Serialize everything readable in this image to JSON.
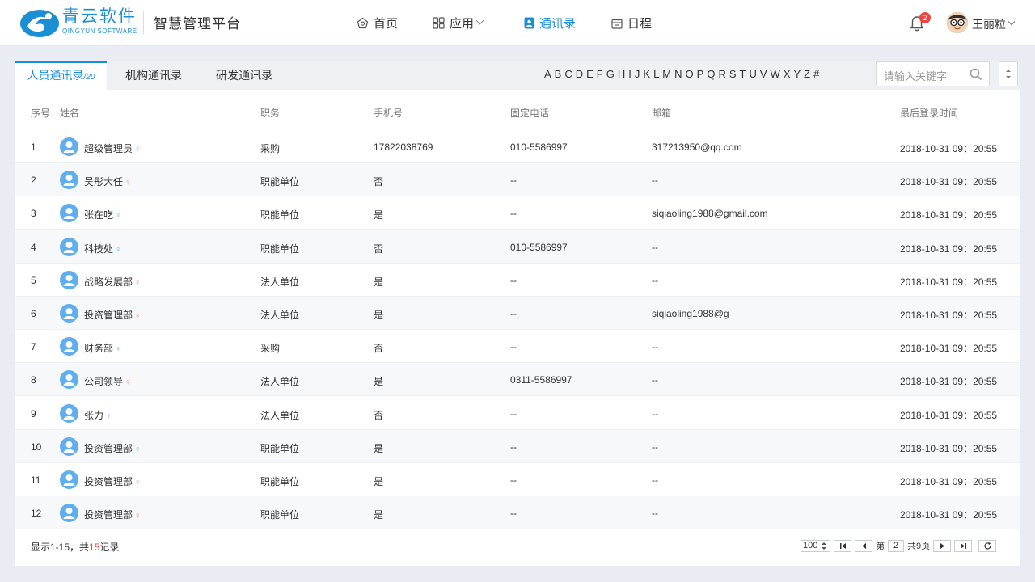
{
  "header": {
    "logo_cn": "青云软件",
    "logo_en": "QINGYUN SOFTWARE",
    "platform_title": "智慧管理平台",
    "nav": {
      "home": "首页",
      "apps": "应用",
      "contacts": "通讯录",
      "calendar": "日程"
    },
    "notification_count": "2",
    "user_name": "王丽粒"
  },
  "tabs": {
    "personnel": "人员通讯录",
    "personnel_count": "/20",
    "org": "机构通讯录",
    "rd": "研发通讯录"
  },
  "alphabet": [
    "A",
    "B",
    "C",
    "D",
    "E",
    "F",
    "G",
    "H",
    "I",
    "J",
    "K",
    "L",
    "M",
    "N",
    "O",
    "P",
    "Q",
    "R",
    "S",
    "T",
    "U",
    "V",
    "W",
    "X",
    "Y",
    "Z",
    "#"
  ],
  "search": {
    "placeholder": "请输入关键字"
  },
  "table": {
    "headers": {
      "index": "序号",
      "name": "姓名",
      "job": "职务",
      "mobile": "手机号",
      "phone": "固定电话",
      "email": "邮箱",
      "last_login": "最后登录时间"
    },
    "rows": [
      {
        "index": "1",
        "name": "超级管理员",
        "gender": "male",
        "job": "采购",
        "mobile": "17822038769",
        "phone": "010-5586997",
        "email": "317213950@qq.com",
        "last_login": "2018-10-31 09：20:55"
      },
      {
        "index": "2",
        "name": "吴彤大任",
        "gender": "female",
        "job": "职能单位",
        "mobile": "否",
        "phone": "--",
        "email": "--",
        "last_login": "2018-10-31 09：20:55"
      },
      {
        "index": "3",
        "name": "张在吃",
        "gender": "male",
        "job": "职能单位",
        "mobile": "是",
        "phone": "--",
        "email": "siqiaoling1988@gmail.com",
        "last_login": "2018-10-31 09：20:55"
      },
      {
        "index": "4",
        "name": "科技处",
        "gender": "male",
        "job": "职能单位",
        "mobile": "否",
        "phone": "010-5586997",
        "email": "--",
        "last_login": "2018-10-31 09：20:55"
      },
      {
        "index": "5",
        "name": "战略发展部",
        "gender": "female",
        "job": "法人单位",
        "mobile": "是",
        "phone": "--",
        "email": "--",
        "last_login": "2018-10-31 09：20:55"
      },
      {
        "index": "6",
        "name": "投资管理部",
        "gender": "female",
        "job": "法人单位",
        "mobile": "是",
        "phone": "--",
        "email": "siqiaoling1988@g",
        "last_login": "2018-10-31 09：20:55"
      },
      {
        "index": "7",
        "name": "财务部",
        "gender": "male",
        "job": "采购",
        "mobile": "否",
        "phone": "--",
        "email": "--",
        "last_login": "2018-10-31 09：20:55"
      },
      {
        "index": "8",
        "name": "公司领导",
        "gender": "female",
        "job": "法人单位",
        "mobile": "是",
        "phone": "0311-5586997",
        "email": "--",
        "last_login": "2018-10-31 09：20:55"
      },
      {
        "index": "9",
        "name": "张力",
        "gender": "male",
        "job": "法人单位",
        "mobile": "否",
        "phone": "--",
        "email": "--",
        "last_login": "2018-10-31 09：20:55"
      },
      {
        "index": "10",
        "name": "投资管理部",
        "gender": "male",
        "job": "职能单位",
        "mobile": "是",
        "phone": "--",
        "email": "--",
        "last_login": "2018-10-31 09：20:55"
      },
      {
        "index": "11",
        "name": "投资管理部",
        "gender": "female",
        "job": "职能单位",
        "mobile": "是",
        "phone": "--",
        "email": "--",
        "last_login": "2018-10-31 09：20:55"
      },
      {
        "index": "12",
        "name": "投资管理部",
        "gender": "female",
        "job": "职能单位",
        "mobile": "是",
        "phone": "--",
        "email": "--",
        "last_login": "2018-10-31 09：20:55"
      }
    ]
  },
  "footer": {
    "range_prefix": "显示1-15，共",
    "total": "15",
    "range_suffix": "记录"
  },
  "pager": {
    "page_size": "100",
    "page_prefix": "第",
    "current_page": "2",
    "total_pages": "共9页"
  },
  "colors": {
    "accent": "#1b8fd6",
    "badge": "#f0443d",
    "male": "#6cc1f0",
    "female": "#f08c8c"
  },
  "icons": {
    "home": "home-icon",
    "apps": "grid-icon",
    "contacts": "contact-book-icon",
    "calendar": "calendar-icon",
    "bell": "bell-icon",
    "search": "search-icon",
    "sort": "sort-icon"
  }
}
